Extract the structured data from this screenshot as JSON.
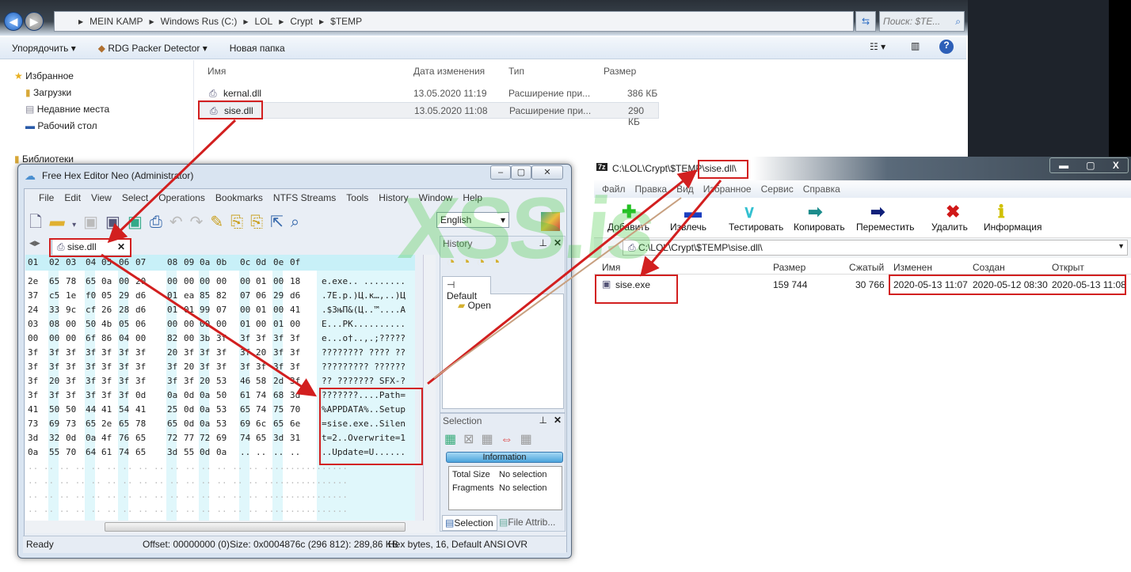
{
  "explorer": {
    "breadcrumb": [
      "MEIN KAMP",
      "Windows Rus (C:)",
      "LOL",
      "Crypt",
      "$TEMP"
    ],
    "search_placeholder": "Поиск: $TE...",
    "toolbar": {
      "organize": "Упорядочить",
      "rdg": "RDG Packer Detector",
      "new_folder": "Новая папка"
    },
    "nav": {
      "favorites": "Избранное",
      "downloads": "Загрузки",
      "recent": "Недавние места",
      "desktop": "Рабочий стол",
      "libraries": "Библиотеки"
    },
    "columns": {
      "name": "Имя",
      "date": "Дата изменения",
      "type": "Тип",
      "size": "Размер"
    },
    "files": [
      {
        "name": "kernal.dll",
        "date": "13.05.2020 11:19",
        "type": "Расширение при...",
        "size": "386 КБ"
      },
      {
        "name": "sise.dll",
        "date": "13.05.2020 11:08",
        "type": "Расширение при...",
        "size": "290 КБ"
      }
    ]
  },
  "hexeditor": {
    "title": "Free Hex Editor Neo (Administrator)",
    "menu": [
      "File",
      "Edit",
      "View",
      "Select",
      "Operations",
      "Bookmarks",
      "NTFS Streams",
      "Tools",
      "History",
      "Window",
      "Help"
    ],
    "language": "English",
    "tab": "sise.dll",
    "header": [
      "01",
      "02",
      "03",
      "04",
      "05",
      "06",
      "07",
      "08",
      "09",
      "0a",
      "0b",
      "0c",
      "0d",
      "0e",
      "0f"
    ],
    "rows": [
      {
        "hex": "2e 65 78 65 0a 00 20 00 00 00 00 00 01 00 18",
        "ascii": "e.exe.. ........"
      },
      {
        "hex": "37 c5 1e f0 05 29 d6 01 ea 85 82 07 06 29 d6",
        "ascii": ".7E.p.)Ц.к…,..)Ц"
      },
      {
        "hex": "24 33 9c cf 26 28 d6 01 01 99 07 00 01 00 41",
        "ascii": ".$3њП&(Ц..™....A"
      },
      {
        "hex": "03 08 00 50 4b 05 06 00 00 00 00 01 00 01 00",
        "ascii": "E...PK.........."
      },
      {
        "hex": "00 00 00 6f 86 04 00 82 00 3b 3f 3f 3f 3f 3f",
        "ascii": "e...o†..‚.;?????"
      },
      {
        "hex": "3f 3f 3f 3f 3f 3f 3f 20 3f 3f 3f 3f 20 3f 3f",
        "ascii": "???????? ???? ??"
      },
      {
        "hex": "3f 3f 3f 3f 3f 3f 3f 3f 20 3f 3f 3f 3f 3f 3f",
        "ascii": "????????? ??????"
      },
      {
        "hex": "3f 20 3f 3f 3f 3f 3f 3f 3f 20 53 46 58 2d 3f",
        "ascii": "?? ??????? SFX-?"
      },
      {
        "hex": "3f 3f 3f 3f 3f 3f 0d 0a 0d 0a 50 61 74 68 3d",
        "ascii": "???????....Path="
      },
      {
        "hex": "41 50 50 44 41 54 41 25 0d 0a 53 65 74 75 70",
        "ascii": "%APPDATA%..Setup"
      },
      {
        "hex": "73 69 73 65 2e 65 78 65 0d 0a 53 69 6c 65 6e",
        "ascii": "=sise.exe..Silen"
      },
      {
        "hex": "3d 32 0d 0a 4f 76 65 72 77 72 69 74 65 3d 31",
        "ascii": "t=2..Overwrite=1"
      },
      {
        "hex": "0a 55 70 64 61 74 65 3d 55 0d 0a .. .. .. ..",
        "ascii": "..Update=U......"
      }
    ],
    "history": {
      "title": "History",
      "tab": "Default",
      "item": "Open"
    },
    "selection": {
      "title": "Selection",
      "info": "Information",
      "total_size_label": "Total Size",
      "total_size": "No selection",
      "fragments_label": "Fragments",
      "fragments": "No selection",
      "tab_selection": "Selection",
      "tab_file": "File Attrib..."
    },
    "status": {
      "ready": "Ready",
      "offset": "Offset: 00000000 (0)",
      "size": "Size: 0x0004876c (296 812): 289,86 KB",
      "mode": "Hex bytes, 16, Default ANSI",
      "ovr": "OVR"
    }
  },
  "sevenzip": {
    "title_prefix": "C:\\LOL\\Crypt\\$TEMP",
    "title_suffix": "\\sise.dll\\",
    "menu": [
      "Файл",
      "Правка",
      "Вид",
      "Избранное",
      "Сервис",
      "Справка"
    ],
    "tools": [
      {
        "label": "Добавить",
        "icon": "plus-icon",
        "color": "#22c022"
      },
      {
        "label": "Извлечь",
        "icon": "minus-icon",
        "color": "#1c3fbf"
      },
      {
        "label": "Тестировать",
        "icon": "check-icon",
        "color": "#33c0d0"
      },
      {
        "label": "Копировать",
        "icon": "copy-arrow-icon",
        "color": "#1c8c8c"
      },
      {
        "label": "Переместить",
        "icon": "move-arrow-icon",
        "color": "#10207a"
      },
      {
        "label": "Удалить",
        "icon": "delete-icon",
        "color": "#d01818"
      },
      {
        "label": "Информация",
        "icon": "info-icon",
        "color": "#d0c000"
      }
    ],
    "path": "C:\\LOL\\Crypt\\$TEMP\\sise.dll\\",
    "columns": {
      "name": "Имя",
      "size": "Размер",
      "packed": "Сжатый",
      "modified": "Изменен",
      "created": "Создан",
      "accessed": "Открыт"
    },
    "file": {
      "name": "sise.exe",
      "size": "159 744",
      "packed": "30 766",
      "modified": "2020-05-13 11:07",
      "created": "2020-05-12 08:30",
      "accessed": "2020-05-13 11:08"
    }
  },
  "watermark": "XSS.is",
  "colors": {
    "annotation": "#d21f1f",
    "watermark": "#3cc83c",
    "hex_header": "#c8f0f8"
  }
}
